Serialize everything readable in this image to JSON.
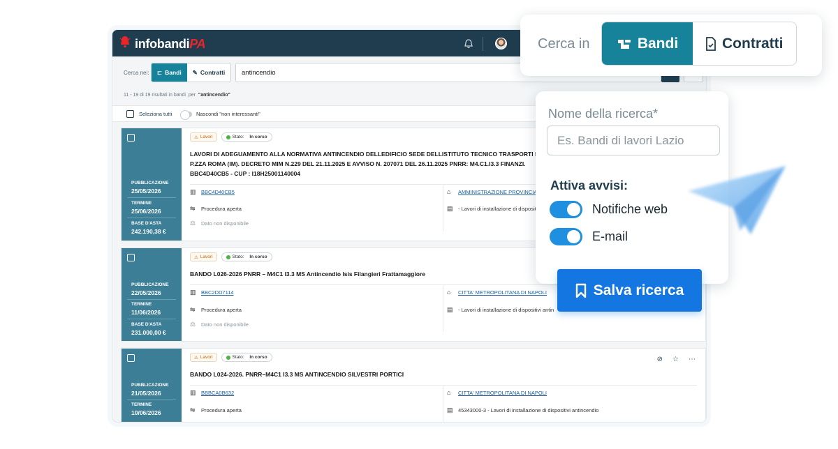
{
  "app": {
    "logo_main": "infobandi",
    "logo_suffix": "PA"
  },
  "search": {
    "cerca_label": "Cerca nei:",
    "seg_bandi": "Bandi",
    "seg_contratti": "Contratti",
    "query": "antincendio"
  },
  "results": {
    "info": "11 - 19 di 19 risultati in bandi",
    "per_label": "per",
    "query_quoted": "\"antincendio\"",
    "select_all": "Seleziona tutti",
    "hide_label": "Nascondi \"non interessanti\""
  },
  "labels": {
    "pubblicazione": "PUBBLICAZIONE",
    "termine": "TERMINE",
    "base_asta": "BASE D'ASTA",
    "lavori": "Lavori",
    "stato_prefix": "Stato:",
    "stato_value": "In corso"
  },
  "cards": [
    {
      "pubblicazione": "25/05/2026",
      "termine": "25/06/2026",
      "base_asta": "242.190,38 €",
      "title_lines": [
        "LAVORI DI ADEGUAMENTO ALLA NORMATIVA ANTINCENDIO DELLEDIFICIO SEDE DELLISTITUTO TECNICO TRASPORTI E",
        "P.ZZA ROMA (IM). DECRETO MIM N.229 DEL 21.11.2025 E AVVISO N. 207071 DEL 26.11.2025 PNRR: M4.C1.I3.3 FINANZI.",
        "BBC4D40CB5 - CUP : I18H25001140004"
      ],
      "cig": "BBC4D40CB5",
      "procedura": "Procedura aperta",
      "dato": "Dato non disponibile",
      "ente": "AMMINISTRAZIONE PROVINCIA",
      "cpv": "- Lavori di installazione di dispositi"
    },
    {
      "pubblicazione": "22/05/2026",
      "termine": "11/06/2026",
      "base_asta": "231.000,00 €",
      "title_lines": [
        "BANDO L026-2026 PNRR – M4C1 I3.3 MS Antincendio Isis Filangieri Frattamaggiore"
      ],
      "cig": "BBC2DD7114",
      "procedura": "Procedura aperta",
      "dato": "Dato non disponibile",
      "ente": "CITTA' METROPOLITANA DI NAPOLI",
      "cpv": "- Lavori di installazione di dispositivi antin"
    },
    {
      "pubblicazione": "21/05/2026",
      "termine": "10/06/2026",
      "title_lines": [
        "BANDO L024-2026. PNRR–M4C1 I3.3 MS ANTINCENDIO SILVESTRI PORTICI"
      ],
      "cig": "BBBCA0B632",
      "procedura": "Procedura aperta",
      "ente": "CITTA' METROPOLITANA DI NAPOLI",
      "cpv": "45343000-3 - Lavori di installazione di dispositivi antincendio"
    }
  ],
  "float_search": {
    "label": "Cerca in",
    "bandi": "Bandi",
    "contratti": "Contratti"
  },
  "save_panel": {
    "name_label": "Nome della ricerca*",
    "name_placeholder": "Es. Bandi di lavori Lazio",
    "alerts_label": "Attiva avvisi:",
    "notif_web": "Notifiche web",
    "email": "E-mail",
    "save_button": "Salva ricerca"
  },
  "colors": {
    "navy": "#1f3d4e",
    "teal": "#17839a",
    "side_teal": "#3b7e96",
    "blue_button": "#1476e0",
    "toggle_blue": "#1f8fe0",
    "brand_red": "#e8262c"
  }
}
